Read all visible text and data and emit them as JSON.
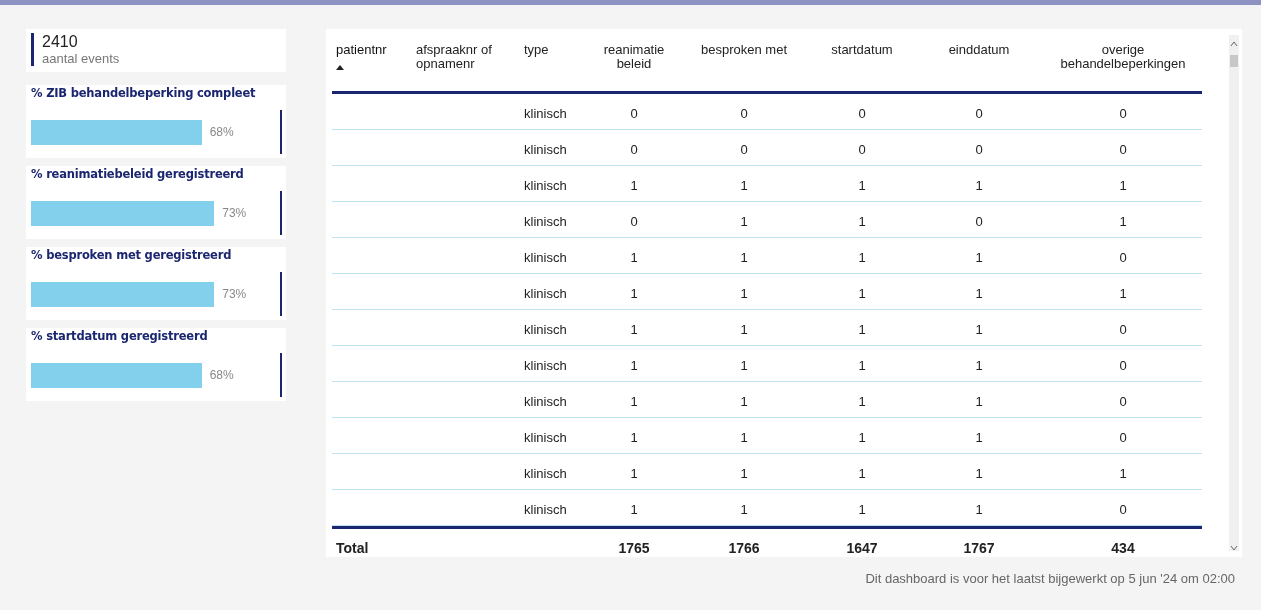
{
  "kpi": {
    "value": "2410",
    "label": "aantal events"
  },
  "measures": [
    {
      "title": "% ZIB behandelbeperking compleet",
      "level": 0.68,
      "reading": "68%"
    },
    {
      "title": "% reanimatiebeleid geregistreerd",
      "level": 0.73,
      "reading": "73%"
    },
    {
      "title": "% besproken met geregistreerd",
      "level": 0.73,
      "reading": "73%"
    },
    {
      "title": "% startdatum geregistreerd",
      "level": 0.68,
      "reading": "68%"
    }
  ],
  "table": {
    "columns": [
      {
        "label": "patientnr",
        "sorted": true
      },
      {
        "label": "afspraaknr of opnamenr",
        "sorted": false
      },
      {
        "label": "type",
        "sorted": false
      },
      {
        "label": "reanimatie beleid",
        "sorted": false
      },
      {
        "label": "besproken met",
        "sorted": false
      },
      {
        "label": "startdatum",
        "sorted": false
      },
      {
        "label": "einddatum",
        "sorted": false
      },
      {
        "label": "overige behandelbeperkingen",
        "sorted": false
      }
    ],
    "rows": [
      {
        "type": "klinisch",
        "values": [
          "0",
          "0",
          "0",
          "0",
          "0"
        ]
      },
      {
        "type": "klinisch",
        "values": [
          "0",
          "0",
          "0",
          "0",
          "0"
        ]
      },
      {
        "type": "klinisch",
        "values": [
          "1",
          "1",
          "1",
          "1",
          "1"
        ]
      },
      {
        "type": "klinisch",
        "values": [
          "0",
          "1",
          "1",
          "0",
          "1"
        ]
      },
      {
        "type": "klinisch",
        "values": [
          "1",
          "1",
          "1",
          "1",
          "0"
        ]
      },
      {
        "type": "klinisch",
        "values": [
          "1",
          "1",
          "1",
          "1",
          "1"
        ]
      },
      {
        "type": "klinisch",
        "values": [
          "1",
          "1",
          "1",
          "1",
          "0"
        ]
      },
      {
        "type": "klinisch",
        "values": [
          "1",
          "1",
          "1",
          "1",
          "0"
        ]
      },
      {
        "type": "klinisch",
        "values": [
          "1",
          "1",
          "1",
          "1",
          "0"
        ]
      },
      {
        "type": "klinisch",
        "values": [
          "1",
          "1",
          "1",
          "1",
          "0"
        ]
      },
      {
        "type": "klinisch",
        "values": [
          "1",
          "1",
          "1",
          "1",
          "1"
        ]
      },
      {
        "type": "klinisch",
        "values": [
          "1",
          "1",
          "1",
          "1",
          "0"
        ]
      }
    ],
    "total": {
      "label": "Total",
      "values": [
        "1765",
        "1766",
        "1647",
        "1767",
        "434"
      ]
    }
  },
  "footer": "Dit dashboard is voor het laatst bijgewerkt op 5 jun '24 om 02:00"
}
